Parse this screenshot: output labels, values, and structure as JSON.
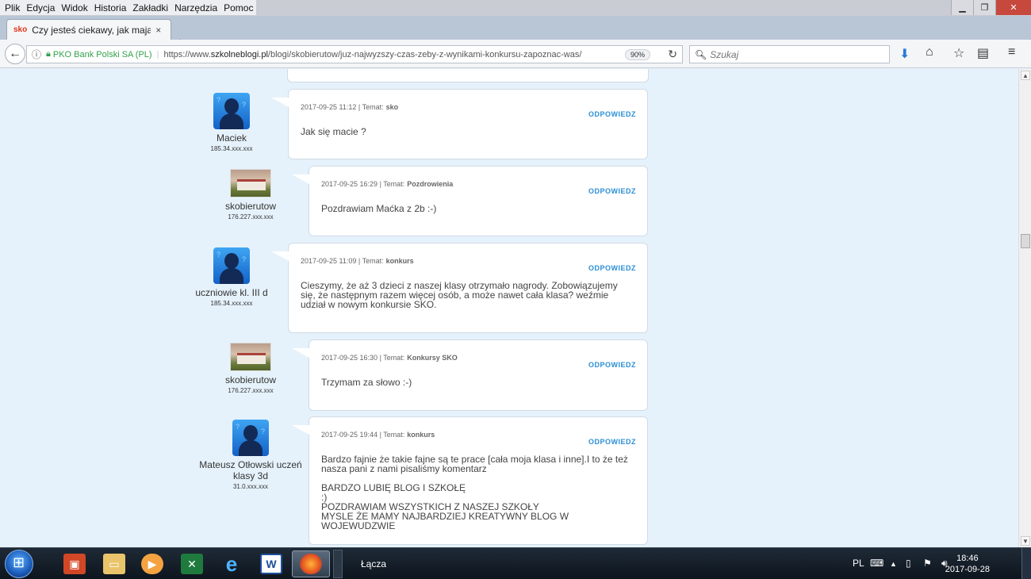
{
  "menu": [
    "Plik",
    "Edycja",
    "Widok",
    "Historia",
    "Zakładki",
    "Narzędzia",
    "Pomoc"
  ],
  "tab": {
    "favicon": "sko",
    "title": "Czy jesteś ciekawy, jak mają s",
    "close": "×",
    "new_tab": "+"
  },
  "address": {
    "org": "PKO Bank Polski SA (PL)",
    "url_prefix": "https://www.",
    "url_domain": "szkolneblogi.pl",
    "url_path": "/blogi/skobierutow/juz-najwyzszy-czas-zeby-z-wynikami-konkursu-zapoznac-was/",
    "zoom": "90%"
  },
  "search": {
    "placeholder": "Szukaj"
  },
  "reply_label": "ODPOWIEDZ",
  "topic_label": "Temat:",
  "comments": [
    {
      "author": "Maciek",
      "ip": "185.34.xxx.xxx",
      "avatar": "default-avatar",
      "date": "2017-09-25 11:12",
      "topic": "sko",
      "text": "Jak się macie ?"
    },
    {
      "author": "skobierutow",
      "ip": "176.227.xxx.xxx",
      "avatar": "school-photo",
      "date": "2017-09-25 16:29",
      "topic": "Pozdrowienia",
      "text": "Pozdrawiam Maćka z 2b :-)"
    },
    {
      "author": "uczniowie kl. III d",
      "ip": "185.34.xxx.xxx",
      "avatar": "default-avatar",
      "date": "2017-09-25 11:09",
      "topic": "konkurs",
      "text": "Cieszymy, że aż 3 dzieci z naszej klasy otrzymało nagrody. Zobowiązujemy się, że następnym razem więcej osób, a może nawet cała klasa? weźmie udział w nowym konkursie SKO."
    },
    {
      "author": "skobierutow",
      "ip": "176.227.xxx.xxx",
      "avatar": "school-photo",
      "date": "2017-09-25 16:30",
      "topic": "Konkursy SKO",
      "text": "Trzymam za słowo :-)"
    },
    {
      "author": "Mateusz Otłowski uczeń klasy 3d",
      "ip": "31.0.xxx.xxx",
      "avatar": "default-avatar",
      "date": "2017-09-25 19:44",
      "topic": "konkurs",
      "text": "Bardzo fajnie że takie fajne są te prace [cała moja klasa i inne].I to że też nasza pani z nami pisaliśmy komentarz\n\nBARDZO LUBIĘ BLOG I SZKOŁĘ\n:)\nPOZDRAWIAM WSZYSTKICH Z NASZEJ SZKOŁY\nMYSLE ŻE MAMY NAJBARDZIEJ KREATYWNY BLOG W WOJEWUDZWIE"
    }
  ],
  "taskbar": {
    "apps": [
      "powerpoint",
      "file-explorer",
      "media-player",
      "excel",
      "internet-explorer",
      "word",
      "firefox"
    ],
    "toolbar_label": "Łącza",
    "lang": "PL",
    "time": "18:46",
    "date": "2017-09-28"
  }
}
